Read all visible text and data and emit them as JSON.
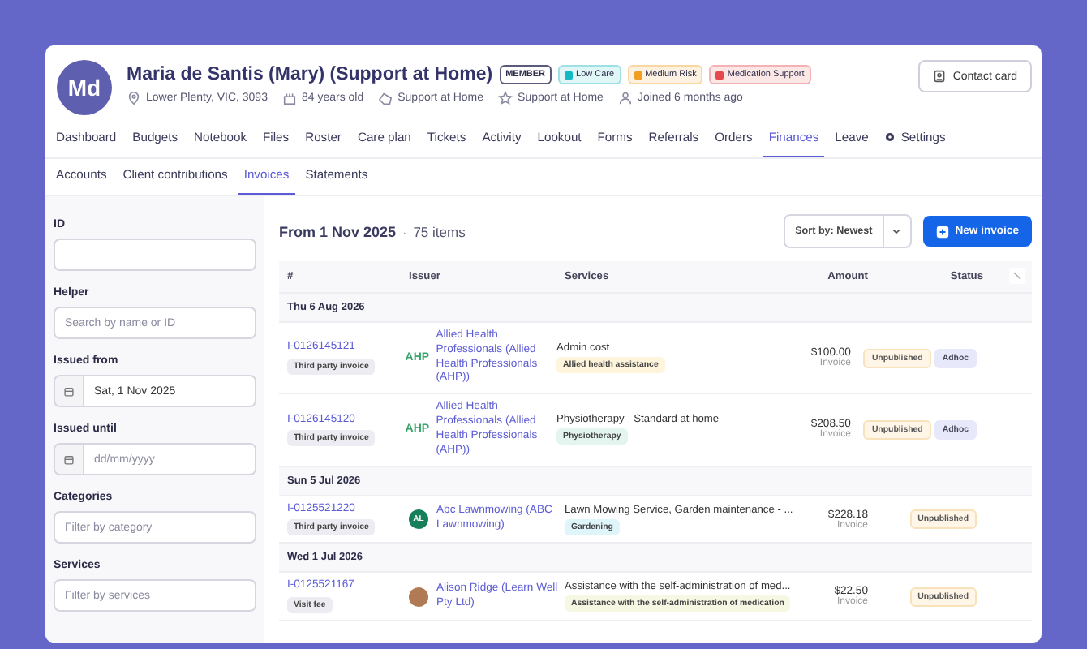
{
  "profile": {
    "initials": "Md",
    "name": "Maria de Santis (Mary) (Support at Home)",
    "badge": "MEMBER",
    "tags": [
      {
        "label": "Low Care",
        "color": "#14b8c4"
      },
      {
        "label": "Medium Risk",
        "color": "#f0a020"
      },
      {
        "label": "Medication Support",
        "color": "#e5484d"
      }
    ],
    "facts": [
      {
        "kind": "location",
        "text": "Lower Plenty, VIC, 3093"
      },
      {
        "kind": "age",
        "text": "84 years old"
      },
      {
        "kind": "program",
        "text": "Support at Home"
      },
      {
        "kind": "plan",
        "text": "Support at Home"
      },
      {
        "kind": "joined",
        "text": "Joined 6 months ago"
      }
    ],
    "contact_button": "Contact card"
  },
  "tabs": [
    {
      "label": "Dashboard",
      "selected": false
    },
    {
      "label": "Budgets",
      "selected": false
    },
    {
      "label": "Notebook",
      "selected": false
    },
    {
      "label": "Files",
      "selected": false
    },
    {
      "label": "Roster",
      "selected": false
    },
    {
      "label": "Care plan",
      "selected": false
    },
    {
      "label": "Tickets",
      "selected": false
    },
    {
      "label": "Activity",
      "selected": false
    },
    {
      "label": "Lookout",
      "selected": false
    },
    {
      "label": "Forms",
      "selected": false
    },
    {
      "label": "Referrals",
      "selected": false
    },
    {
      "label": "Orders",
      "selected": false
    },
    {
      "label": "Finances",
      "selected": true
    },
    {
      "label": "Leave",
      "selected": false
    },
    {
      "label": "Settings",
      "selected": false,
      "icon": true
    }
  ],
  "subtabs": [
    {
      "label": "Accounts",
      "selected": false
    },
    {
      "label": "Client contributions",
      "selected": false
    },
    {
      "label": "Invoices",
      "selected": true
    },
    {
      "label": "Statements",
      "selected": false
    }
  ],
  "filters": [
    {
      "label": "ID",
      "kind": "text"
    },
    {
      "label": "Helper",
      "kind": "text",
      "placeholder": "Search by name or ID"
    },
    {
      "label": "Issued from",
      "kind": "date",
      "value": "Sat, 1 Nov 2025"
    },
    {
      "label": "Issued until",
      "kind": "date",
      "placeholder": "dd/mm/yyyy"
    },
    {
      "label": "Categories",
      "kind": "text",
      "placeholder": "Filter by category"
    },
    {
      "label": "Services",
      "kind": "text",
      "placeholder": "Filter by services"
    }
  ],
  "summary": {
    "range": "From 1 Nov 2025",
    "separator": "·",
    "count": "75 items"
  },
  "sort": "Sort by: Newest",
  "new_button": "New invoice",
  "table": {
    "columns": [
      "#",
      "Issuer",
      "Services",
      "Amount",
      "Status"
    ],
    "groups": [
      {
        "date": "Thu 6 Aug 2026",
        "rows": [
          {
            "id": "I-0126145121",
            "type": "Third party invoice",
            "issuer": "Allied Health Professionals (Allied Health Professionals (AHP))",
            "avatar": {
              "kind": "logo",
              "text": "AHP"
            },
            "service": "Admin cost",
            "category": {
              "label": "Allied health assistance",
              "color": "#fff4dc"
            },
            "amount": "$100.00",
            "amount_label": "Invoice",
            "statuses": [
              "Unpublished",
              "Adhoc"
            ]
          },
          {
            "id": "I-0126145120",
            "type": "Third party invoice",
            "issuer": "Allied Health Professionals (Allied Health Professionals (AHP))",
            "avatar": {
              "kind": "logo",
              "text": "AHP"
            },
            "service": "Physiotherapy - Standard at home",
            "category": {
              "label": "Physiotherapy",
              "color": "#e3f5ee"
            },
            "amount": "$208.50",
            "amount_label": "Invoice",
            "statuses": [
              "Unpublished",
              "Adhoc"
            ]
          }
        ]
      },
      {
        "date": "Sun 5 Jul 2026",
        "rows": [
          {
            "id": "I-0125521220",
            "type": "Third party invoice",
            "issuer": "Abc Lawnmowing (ABC Lawnmowing)",
            "avatar": {
              "kind": "initials",
              "text": "AL"
            },
            "service": "Lawn Mowing Service, Garden maintenance - ...",
            "category": {
              "label": "Gardening",
              "color": "#def5fa"
            },
            "amount": "$228.18",
            "amount_label": "Invoice",
            "statuses": [
              "Unpublished"
            ]
          }
        ]
      },
      {
        "date": "Wed 1 Jul 2026",
        "rows": [
          {
            "id": "I-0125521167",
            "type": "Visit fee",
            "issuer": "Alison Ridge (Learn Well Pty Ltd)",
            "avatar": {
              "kind": "photo"
            },
            "service": "Assistance with the self-administration of med...",
            "category": {
              "label": "Assistance with the self-administration of medication",
              "color": "#f6f8e4"
            },
            "amount": "$22.50",
            "amount_label": "Invoice",
            "statuses": [
              "Unpublished"
            ]
          }
        ]
      }
    ]
  }
}
